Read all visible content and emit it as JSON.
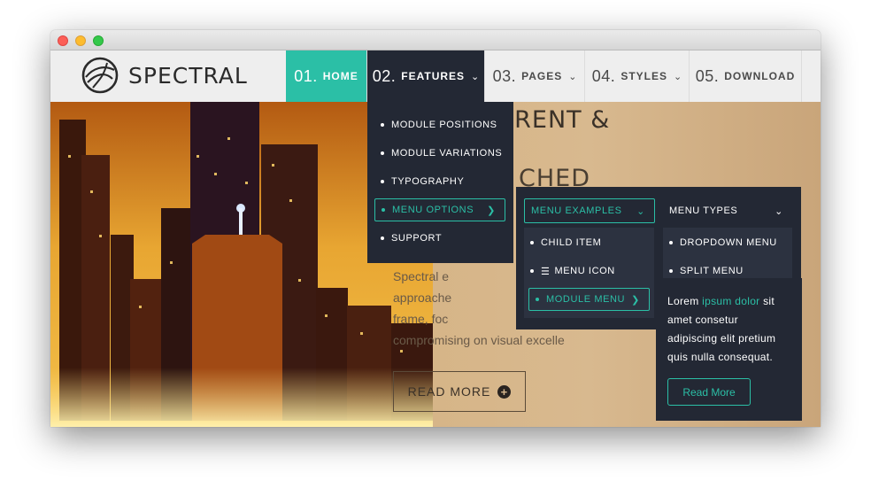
{
  "brand": {
    "name": "SPECTRAL"
  },
  "nav": [
    {
      "num": "01.",
      "label": "HOME"
    },
    {
      "num": "02.",
      "label": "FEATURES"
    },
    {
      "num": "03.",
      "label": "PAGES"
    },
    {
      "num": "04.",
      "label": "STYLES"
    },
    {
      "num": "05.",
      "label": "DOWNLOAD"
    }
  ],
  "hero": {
    "title_line1": "SPARENT &",
    "title_line2": "CHED",
    "body": [
      "Spectral e",
      "approache",
      "frame, foc",
      "compromising on visual excelle"
    ],
    "read_more": "READ MORE"
  },
  "features_menu": {
    "items": [
      "MODULE POSITIONS",
      "MODULE VARIATIONS",
      "TYPOGRAPHY",
      "MENU OPTIONS",
      "SUPPORT"
    ]
  },
  "menu_options_sub": {
    "col1_title": "MENU EXAMPLES",
    "col2_title": "MENU TYPES",
    "col1_items": [
      "CHILD ITEM",
      "MENU ICON",
      "MODULE MENU"
    ],
    "col2_items": [
      "DROPDOWN MENU",
      "SPLIT MENU"
    ]
  },
  "promo": {
    "word1": "Lorem",
    "highlight": "ipsum dolor",
    "rest1": "sit",
    "line2": "amet consetur",
    "line3": "adipiscing elit pretium",
    "line4": "quis nulla consequat.",
    "button": "Read More"
  },
  "colors": {
    "accent": "#2bbfa6",
    "dark": "#232834",
    "navbar": "#eeeeee"
  }
}
